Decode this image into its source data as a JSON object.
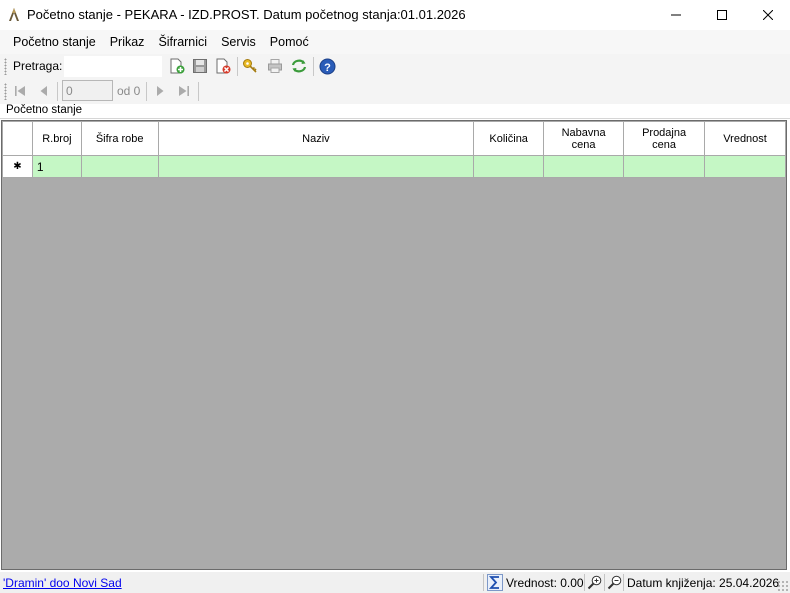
{
  "window": {
    "title": "Početno stanje - PEKARA - IZD.PROST. Datum početnog stanja:01.01.2026",
    "minimize_symbol": "—",
    "maximize_symbol": "☐",
    "close_symbol": "✕"
  },
  "menu": {
    "items": [
      "Početno stanje",
      "Prikaz",
      "Šifrarnici",
      "Servis",
      "Pomoć"
    ]
  },
  "toolbar": {
    "search_label": "Pretraga:",
    "search_value": "",
    "icons": [
      "new-document-icon",
      "save-icon",
      "delete-document-icon",
      "key-icon",
      "print-icon",
      "refresh-icon",
      "help-icon"
    ]
  },
  "navigator": {
    "position_value": "0",
    "of_label": "od 0",
    "icons": [
      "first-record-icon",
      "previous-record-icon",
      "next-record-icon",
      "last-record-icon"
    ]
  },
  "section": {
    "title": "Početno stanje"
  },
  "grid": {
    "columns": [
      {
        "label": "R.broj"
      },
      {
        "label": "Šifra robe"
      },
      {
        "label": "Naziv"
      },
      {
        "label": "Količina"
      },
      {
        "label": "Nabavna cena"
      },
      {
        "label": "Prodajna cena"
      },
      {
        "label": "Vrednost"
      }
    ],
    "new_row": {
      "marker": "✱",
      "cells": [
        "1",
        "",
        "",
        "",
        "",
        "",
        ""
      ]
    },
    "row_highlight_color": "#c5f7c5",
    "empty_area_color": "#ababab"
  },
  "status": {
    "company": "'Dramin' doo Novi Sad",
    "value_label": "Vrednost: 0.00",
    "date_label": "Datum knjiženja: 25.04.2026"
  }
}
